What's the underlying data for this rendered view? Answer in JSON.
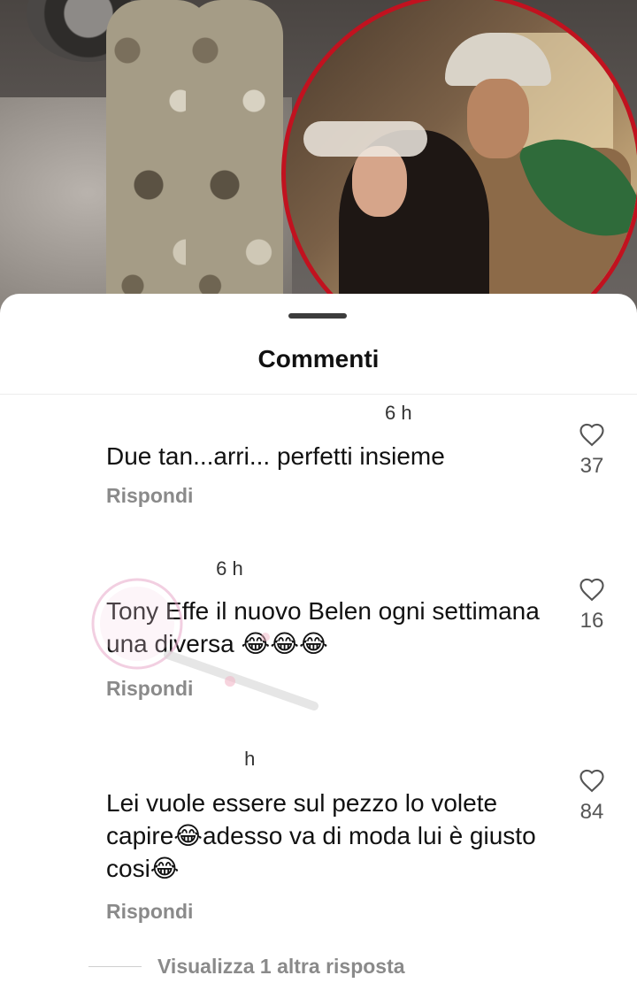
{
  "sheet": {
    "title": "Commenti"
  },
  "comments": [
    {
      "username": "",
      "time": "6 h",
      "text": "Due tan...arri... perfetti insieme",
      "reply_label": "Rispondi",
      "likes": "37"
    },
    {
      "username": "",
      "time": "6 h",
      "text": "Tony Effe il nuovo Belen ogni settimana una diversa 😂😂😂",
      "reply_label": "Rispondi",
      "likes": "16"
    },
    {
      "username": "",
      "time": "h",
      "text": "Lei vuole essere sul pezzo lo volete capire😂adesso va di moda lui è giusto cosi😂",
      "reply_label": "Rispondi",
      "likes": "84"
    }
  ],
  "replies": {
    "view_more_label": "Visualizza 1 altra risposta"
  },
  "icons": {
    "like": "heart-icon"
  },
  "colors": {
    "inset_border": "#c1121f",
    "reply_gray": "#8a8a8a"
  }
}
